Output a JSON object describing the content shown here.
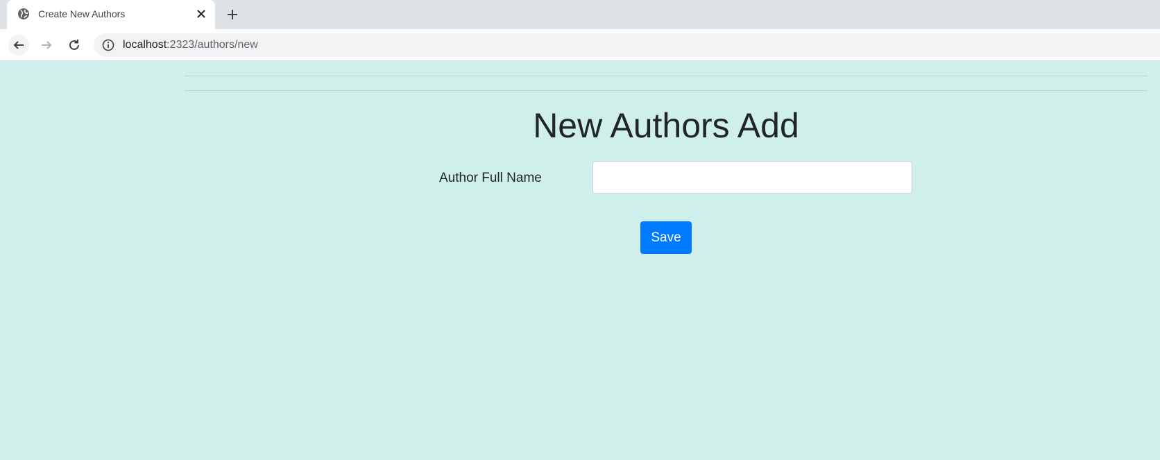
{
  "browser": {
    "tab": {
      "title": "Create New Authors",
      "favicon": "globe-icon"
    },
    "address": {
      "host": "localhost",
      "path": ":2323/authors/new"
    }
  },
  "page": {
    "heading": "New Authors Add",
    "form": {
      "author_name_label": "Author Full Name",
      "author_name_value": "",
      "save_label": "Save"
    }
  },
  "colors": {
    "background": "#cff0ea",
    "primary_button": "#007bff",
    "text": "#212529"
  }
}
